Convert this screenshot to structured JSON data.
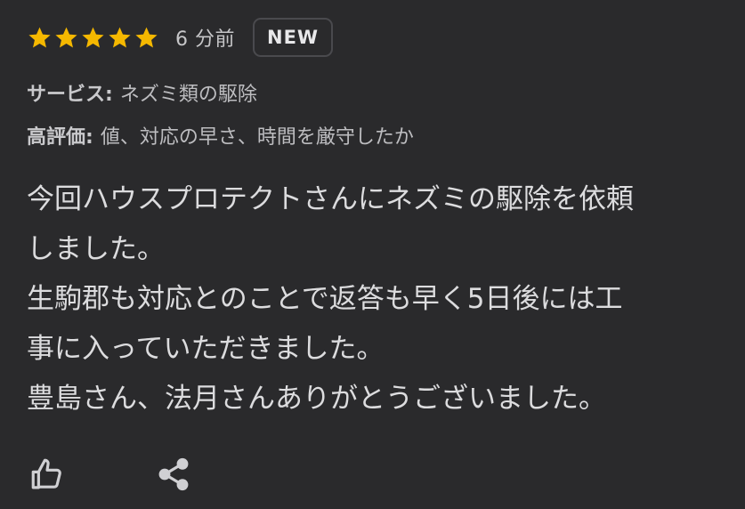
{
  "review": {
    "rating": 5,
    "time_ago": "6 分前",
    "badge": "NEW",
    "service": {
      "label": "サービス:",
      "value": "ネズミ類の駆除"
    },
    "praised": {
      "label": "高評価:",
      "value": "値、対応の早さ、時間を厳守したか"
    },
    "body_lines": [
      "今回ハウスプロテクトさんにネズミの駆除を依頼",
      "しました。",
      "生駒郡も対応とのことで返答も早く5日後には工",
      "事に入っていただきました。",
      "豊島さん、法月さんありがとうございました。"
    ]
  },
  "colors": {
    "star": "#f5b800",
    "background": "#2a2a2c",
    "badge_border": "#4a4a4e"
  },
  "icons": {
    "like": "thumbs-up-icon",
    "share": "share-icon",
    "star": "star-icon"
  }
}
